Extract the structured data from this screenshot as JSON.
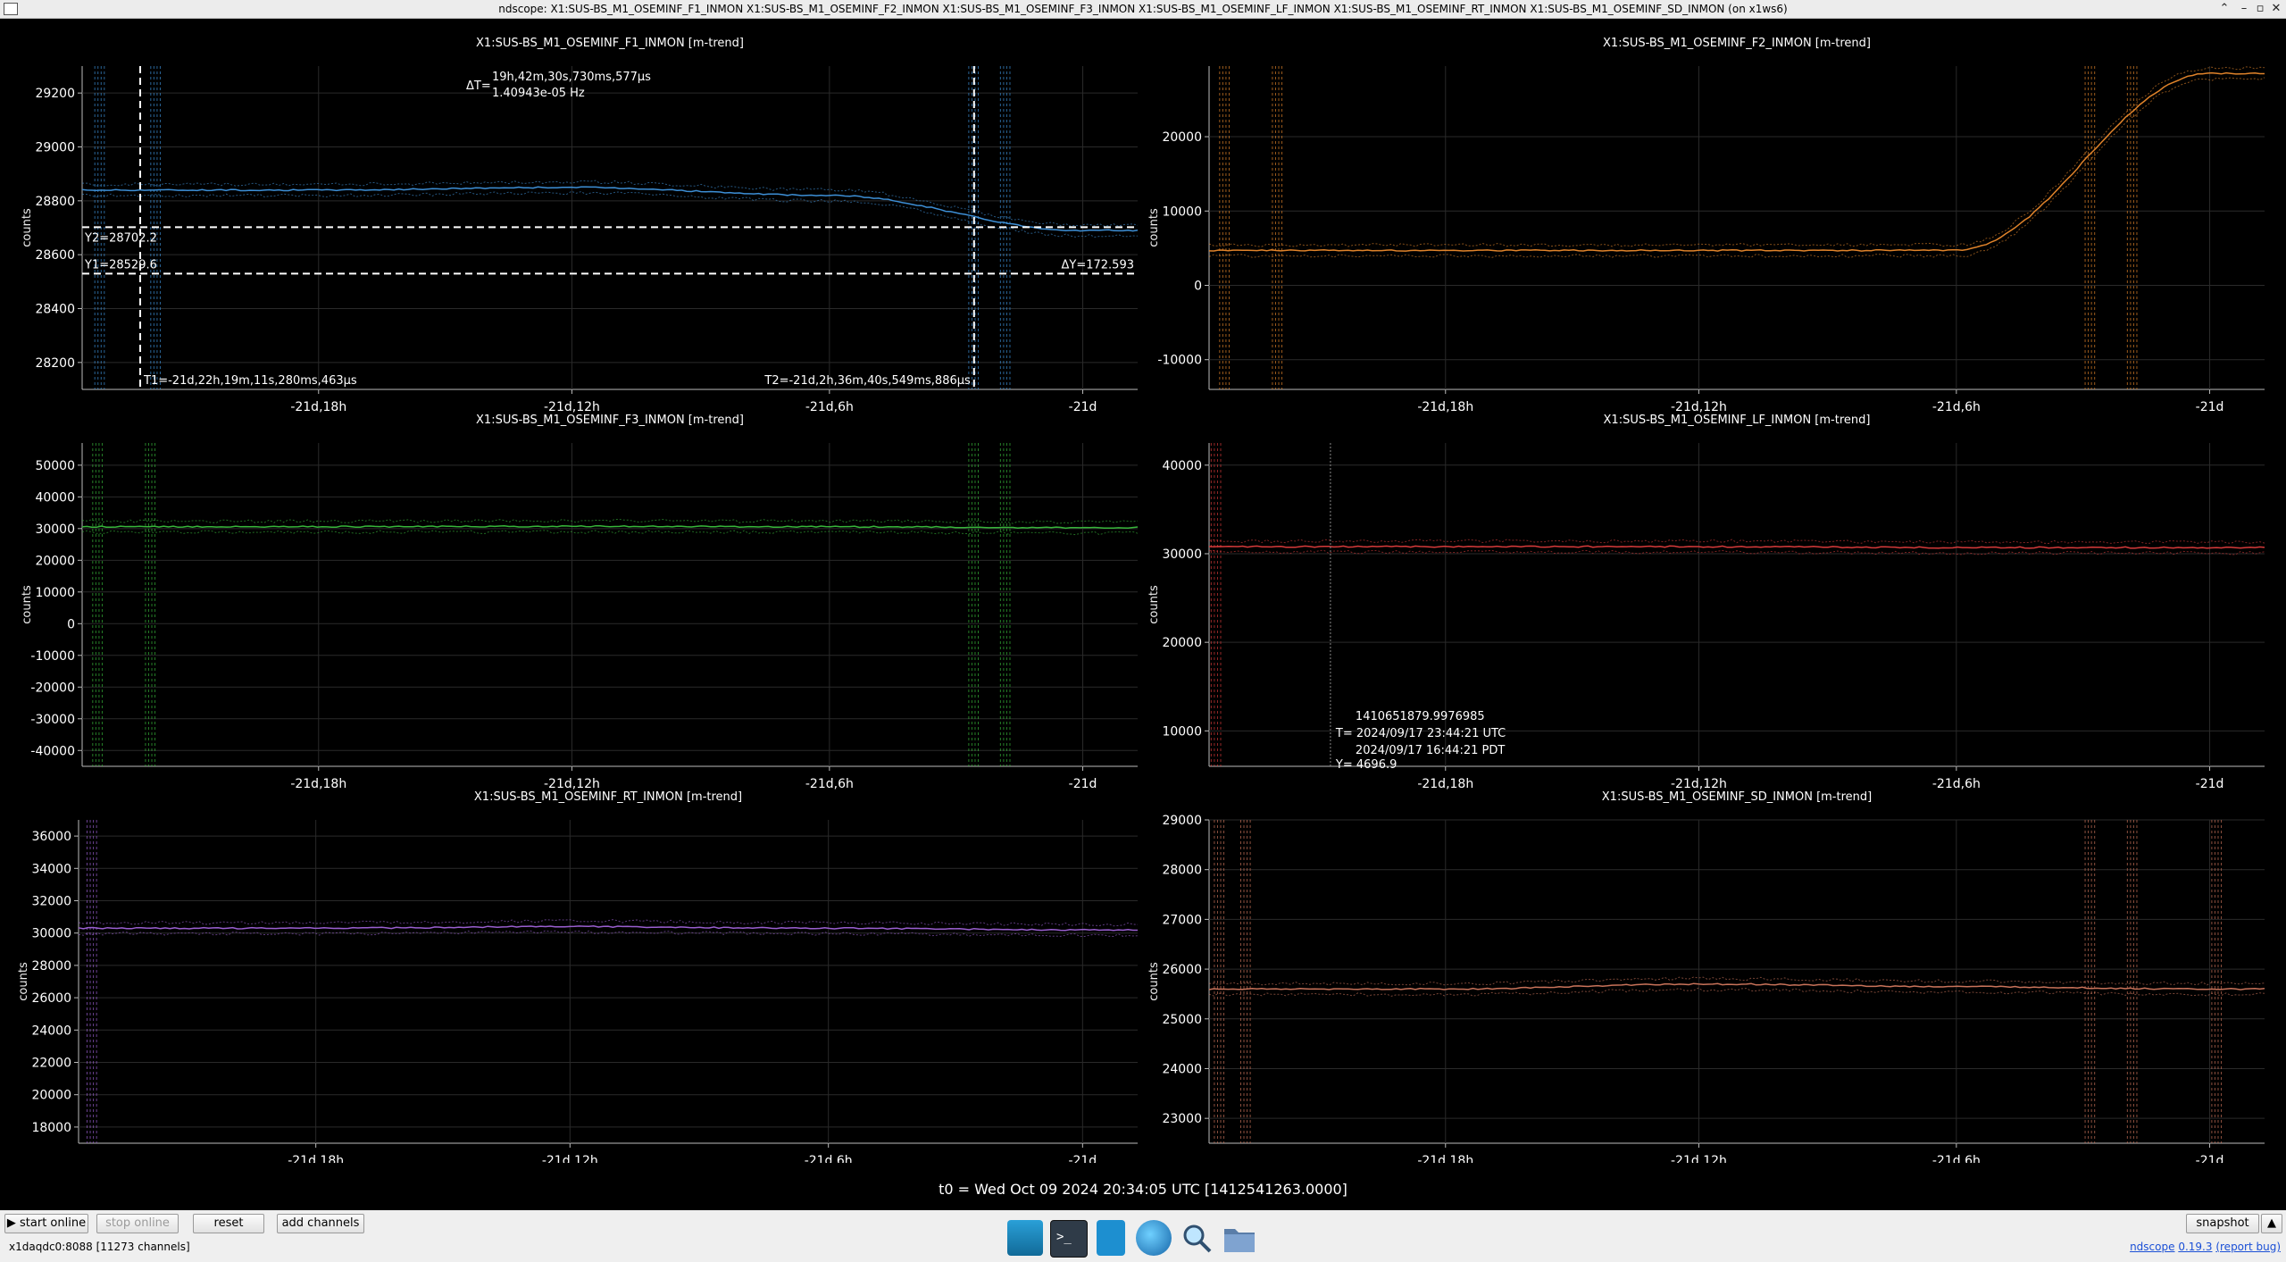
{
  "window": {
    "title": "ndscope: X1:SUS-BS_M1_OSEMINF_F1_INMON X1:SUS-BS_M1_OSEMINF_F2_INMON X1:SUS-BS_M1_OSEMINF_F3_INMON X1:SUS-BS_M1_OSEMINF_LF_INMON X1:SUS-BS_M1_OSEMINF_RT_INMON X1:SUS-BS_M1_OSEMINF_SD_INMON (on x1ws6)",
    "buttons": [
      "minimize-icon",
      "maximize-icon",
      "close-icon"
    ]
  },
  "x_ticks": [
    "-21d,18h",
    "-21d,12h",
    "-21d,6h",
    "-21d"
  ],
  "plots": [
    {
      "id": "f1",
      "title": "X1:SUS-BS_M1_OSEMINF_F1_INMON [m-trend]",
      "ylabel": "counts",
      "color": "#3d8fd6",
      "yticks": [
        "29200",
        "29000",
        "28800",
        "28600",
        "28400",
        "28200"
      ],
      "cursors": {
        "dT": "ΔT=",
        "dT_value1": "19h,42m,30s,730ms,577µs",
        "dT_value2": "1.40943e-05 Hz",
        "y2": "Y2=28702.2",
        "y1": "Y1=28529.6",
        "dY": "ΔY=172.593",
        "t1": "T1=-21d,22h,19m,11s,280ms,463µs",
        "t2": "T2=-21d,2h,36m,40s,549ms,886µs"
      }
    },
    {
      "id": "f2",
      "title": "X1:SUS-BS_M1_OSEMINF_F2_INMON [m-trend]",
      "ylabel": "counts",
      "color": "#e0832a",
      "yticks": [
        "20000",
        "10000",
        "0",
        "-10000"
      ]
    },
    {
      "id": "f3",
      "title": "X1:SUS-BS_M1_OSEMINF_F3_INMON [m-trend]",
      "ylabel": "counts",
      "color": "#37b63a",
      "yticks": [
        "50000",
        "40000",
        "30000",
        "20000",
        "10000",
        "0",
        "-10000",
        "-20000",
        "-30000",
        "-40000"
      ]
    },
    {
      "id": "lf",
      "title": "X1:SUS-BS_M1_OSEMINF_LF_INMON [m-trend]",
      "ylabel": "counts",
      "color": "#d63a3a",
      "yticks": [
        "40000",
        "30000",
        "20000",
        "10000"
      ],
      "crosshair": {
        "line1": "1410651879.9976985",
        "line2": "T= 2024/09/17 23:44:21 UTC",
        "line3": "2024/09/17 16:44:21 PDT",
        "line4": "Y= 4696.9"
      }
    },
    {
      "id": "rt",
      "title": "X1:SUS-BS_M1_OSEMINF_RT_INMON [m-trend]",
      "ylabel": "counts",
      "color": "#9a5fd0",
      "yticks": [
        "36000",
        "34000",
        "32000",
        "30000",
        "28000",
        "26000",
        "24000",
        "22000",
        "20000",
        "18000"
      ]
    },
    {
      "id": "sd",
      "title": "X1:SUS-BS_M1_OSEMINF_SD_INMON [m-trend]",
      "ylabel": "counts",
      "color": "#c9735a",
      "yticks": [
        "29000",
        "28000",
        "27000",
        "26000",
        "25000",
        "24000",
        "23000"
      ]
    }
  ],
  "chart_data": [
    {
      "type": "line",
      "title": "X1:SUS-BS_M1_OSEMINF_F1_INMON [m-trend]",
      "ylabel": "counts",
      "ylim": [
        28100,
        29300
      ],
      "x": [
        "-21d,18h",
        "-21d,12h",
        "-21d,6h",
        "-21d"
      ],
      "series": [
        {
          "name": "X1:SUS-BS_M1_OSEMINF_F1_INMON",
          "values": [
            28840,
            28850,
            28820,
            28690
          ]
        }
      ]
    },
    {
      "type": "line",
      "title": "X1:SUS-BS_M1_OSEMINF_F2_INMON [m-trend]",
      "ylabel": "counts",
      "ylim": [
        -14000,
        29500
      ],
      "x": [
        "-21d,18h",
        "-21d,12h",
        "-21d,6h",
        "-21d"
      ],
      "series": [
        {
          "name": "X1:SUS-BS_M1_OSEMINF_F2_INMON",
          "values": [
            4700,
            4700,
            4700,
            28500
          ]
        }
      ]
    },
    {
      "type": "line",
      "title": "X1:SUS-BS_M1_OSEMINF_F3_INMON [m-trend]",
      "ylabel": "counts",
      "ylim": [
        -45000,
        57000
      ],
      "x": [
        "-21d,18h",
        "-21d,12h",
        "-21d,6h",
        "-21d"
      ],
      "series": [
        {
          "name": "X1:SUS-BS_M1_OSEMINF_F3_INMON",
          "values": [
            30600,
            30700,
            30600,
            30300
          ]
        }
      ]
    },
    {
      "type": "line",
      "title": "X1:SUS-BS_M1_OSEMINF_LF_INMON [m-trend]",
      "ylabel": "counts",
      "ylim": [
        6000,
        42500
      ],
      "x": [
        "-21d,18h",
        "-21d,12h",
        "-21d,6h",
        "-21d"
      ],
      "series": [
        {
          "name": "X1:SUS-BS_M1_OSEMINF_LF_INMON",
          "values": [
            30800,
            30800,
            30700,
            30700
          ]
        }
      ]
    },
    {
      "type": "line",
      "title": "X1:SUS-BS_M1_OSEMINF_RT_INMON [m-trend]",
      "ylabel": "counts",
      "ylim": [
        17000,
        37000
      ],
      "x": [
        "-21d,18h",
        "-21d,12h",
        "-21d,6h",
        "-21d"
      ],
      "series": [
        {
          "name": "X1:SUS-BS_M1_OSEMINF_RT_INMON",
          "values": [
            30300,
            30400,
            30300,
            30200
          ]
        }
      ]
    },
    {
      "type": "line",
      "title": "X1:SUS-BS_M1_OSEMINF_SD_INMON [m-trend]",
      "ylabel": "counts",
      "ylim": [
        22500,
        29000
      ],
      "x": [
        "-21d,18h",
        "-21d,12h",
        "-21d,6h",
        "-21d"
      ],
      "series": [
        {
          "name": "X1:SUS-BS_M1_OSEMINF_SD_INMON",
          "values": [
            25600,
            25700,
            25650,
            25600
          ]
        }
      ]
    }
  ],
  "t0": "t0 = Wed Oct 09 2024 20:34:05 UTC [1412541263.0000]",
  "bottom": {
    "start_online": "▶ start online",
    "stop_online": "stop online",
    "reset": "reset",
    "add_channels": "add channels",
    "snapshot": "snapshot",
    "status": "x1daqdc0:8088  [11273 channels]",
    "ndscope": "ndscope",
    "version": "0.19.3",
    "report_bug": "(report bug)"
  },
  "taskbar": [
    "desktop-icon",
    "terminal-icon",
    "text-editor-icon",
    "web-browser-icon",
    "search-icon",
    "files-icon"
  ]
}
